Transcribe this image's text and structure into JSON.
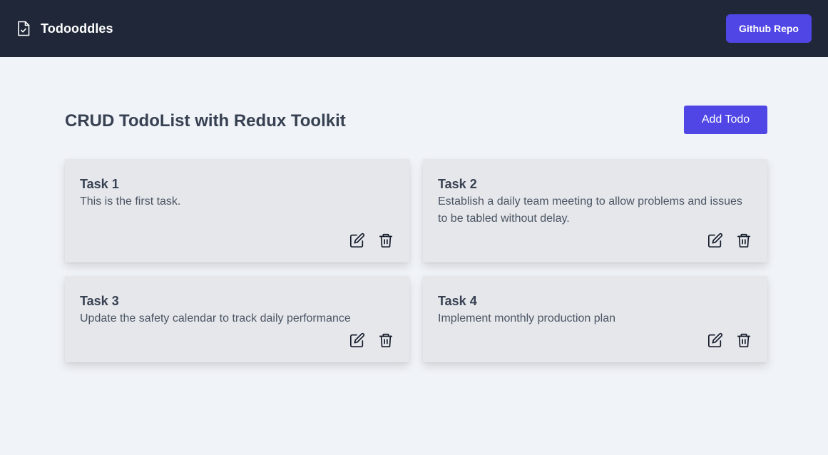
{
  "navbar": {
    "brand": "Todooddles",
    "brand_icon": "file-check-icon",
    "github_label": "Github Repo",
    "bg_color": "#1f2738",
    "accent_color": "#4f46e5"
  },
  "main": {
    "title": "CRUD TodoList with Redux Toolkit",
    "add_label": "Add Todo"
  },
  "todos": [
    {
      "title": "Task 1",
      "description": "This is the first task."
    },
    {
      "title": "Task 2",
      "description": "Establish a daily team meeting to allow problems and issues to be tabled without delay."
    },
    {
      "title": "Task 3",
      "description": "Update the safety calendar to track daily performance"
    },
    {
      "title": "Task 4",
      "description": "Implement monthly production plan"
    }
  ],
  "icons": {
    "edit": "edit-icon",
    "delete": "trash-icon"
  }
}
